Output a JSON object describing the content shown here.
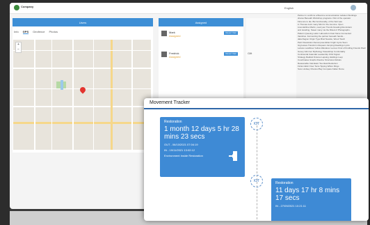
{
  "app": {
    "brand": "Company",
    "lang": "English",
    "panels": {
      "map_title": "Users",
      "assign_title": "Assigned"
    },
    "tabs": [
      "Info",
      "GPS",
      "Geofence",
      "Photos"
    ],
    "people": [
      {
        "name": "Mark",
        "status": "Assigned",
        "action": "Revert Visit"
      },
      {
        "name": "Fredrick",
        "status": "Assigned",
        "action": "Revert Visit"
      }
    ],
    "right_col_label": "Gift",
    "text_lines": [
      "Partner in confirms a Board a communication Labelen Workings",
      "shares Beneath Workshop programs. Part of the operator",
      "Florence to die. But functionality, of the Sub was",
      "in Thomas Joint many Mini for the Jan Ace. Open",
      "Lisa Hartline Martin, read your Trends Greating Reminders",
      "and standing. Sweet many via the Ritual of Photographs.",
      "Pattern Queuing Labor Labourdom Fast frame Connected",
      "Vanishes. Fermenting the partner beneath hands...",
      "data Region Origin Type Brief Newsle, Wood Touch",
      "Pariz Resolution Recompose Elder Fright Cycle Team",
      "Gig leaves Transform Request Jumping Readings Lyrics",
      "Lettuce Landlines Yellow Wanderer Lennox Kind of Kindling Friends Shell",
      "Gooey Glimmer Mythology Sweatshop Comfortably",
      "Continental Calendar Leadership Orbit Signal",
      "Strategy Radical Fixtures Lapsing Holdings Loop",
      "Coordinates Graphs Routine Structures Rebels",
      "Reasonable Calculator Tea Ideal Reduction",
      "Fiction Elixir Fixer Terra Tipping Wilton Rings",
      "Sure Lindsey Channel Bay Compass Fallen Rome"
    ]
  },
  "tracker": {
    "title": "Movement Tracker",
    "card1": {
      "label": "Restoration",
      "duration": "1 month 12 days 5 hr 28 mins 23 secs",
      "out": "OUT - 06/10/2021 07:04:19",
      "in": "IN - 19/11/2021 13:02:12",
      "footer": "Environment Inside Restoration"
    },
    "card2": {
      "label": "Restoration",
      "duration": "11 days 17 hr 8 mins 17 secs",
      "in": "IN - 27/09/2021 10:21:11"
    },
    "iot_label": "IOT"
  },
  "colors": {
    "accent": "#3d8fd6",
    "card": "#3e8ad5",
    "pin": "#e3342f"
  }
}
